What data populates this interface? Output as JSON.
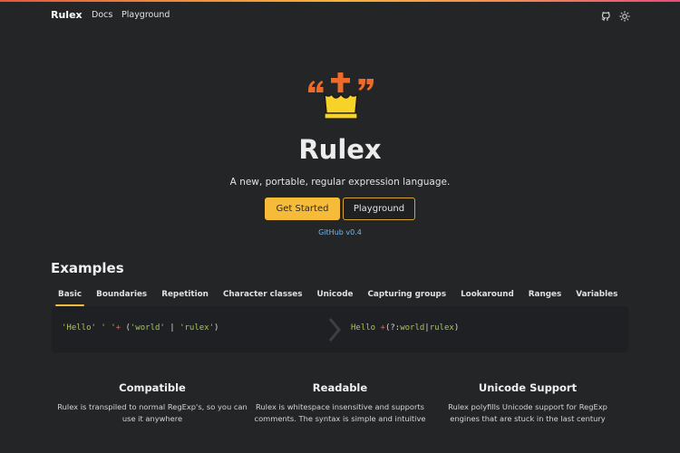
{
  "navbar": {
    "brand": "Rulex",
    "links": [
      "Docs",
      "Playground"
    ],
    "icons": [
      "github-icon",
      "theme-toggle-icon"
    ]
  },
  "hero": {
    "title": "Rulex",
    "subtitle": "A new, portable, regular expression language.",
    "primary_button": "Get Started",
    "secondary_button": "Playground",
    "github_link": "GitHub v0.4"
  },
  "examples": {
    "heading": "Examples",
    "tabs": [
      "Basic",
      "Boundaries",
      "Repetition",
      "Character classes",
      "Unicode",
      "Capturing groups",
      "Lookaround",
      "Ranges",
      "Variables"
    ],
    "active_tab": "Basic",
    "input_code": {
      "s1": "'Hello'",
      "s2": "' '",
      "op": "+",
      "lp": "(",
      "s3": "'world'",
      "pipe": "|",
      "s4": "'rulex'",
      "rp": ")"
    },
    "output_code": {
      "hello": "Hello ",
      "plus": "+",
      "group_open": "(?:",
      "world": "world",
      "pipe": "|",
      "rulex": "rulex",
      "group_close": ")"
    }
  },
  "features": [
    {
      "title": "Compatible",
      "text": "Rulex is transpiled to normal RegExp's, so you can use it anywhere"
    },
    {
      "title": "Readable",
      "text": "Rulex is whitespace insensitive and supports comments. The syntax is simple and intuitive"
    },
    {
      "title": "Unicode Support",
      "text": "Rulex polyfills Unicode support for RegExp engines that are stuck in the last century"
    }
  ],
  "colors": {
    "accent": "#f6bb39",
    "background": "#242526",
    "code_background": "#1e2023",
    "string": "#a6c94e",
    "operator": "#e8674a",
    "link": "#7bb6e8"
  }
}
